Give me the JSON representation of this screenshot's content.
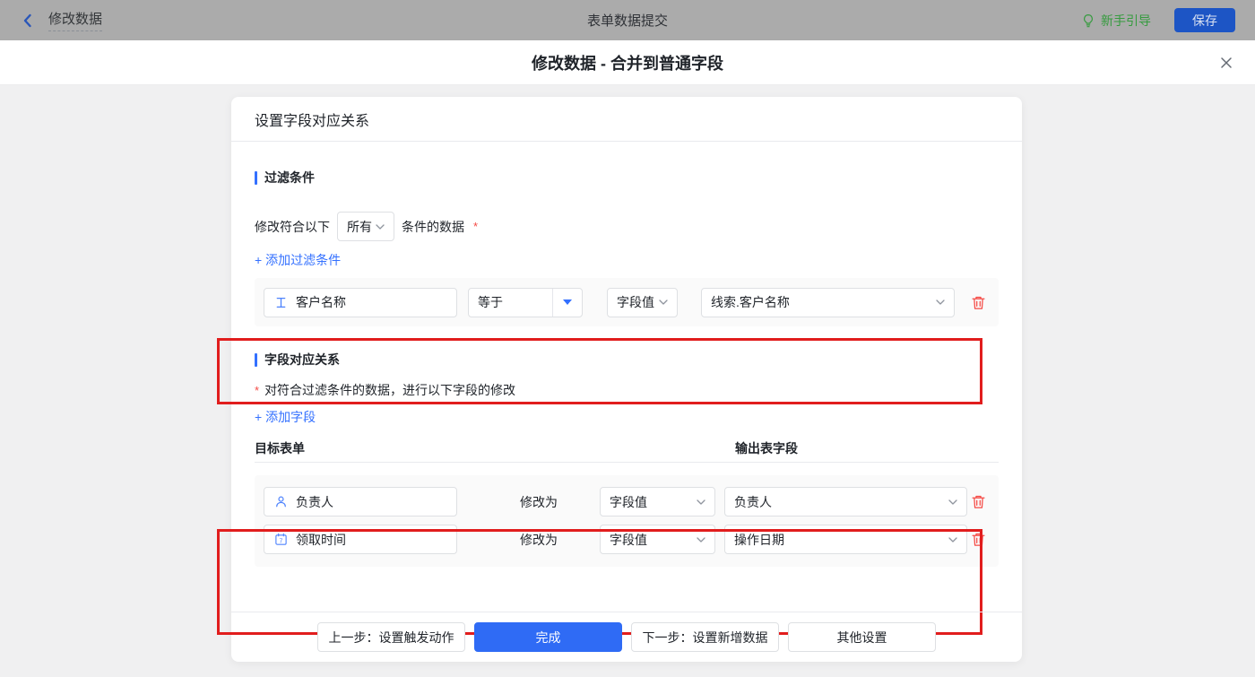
{
  "topbar": {
    "back_label": "修改数据",
    "center_title": "表单数据提交",
    "guide_label": "新手引导",
    "save_label": "保存"
  },
  "modal": {
    "title": "修改数据 - 合并到普通字段"
  },
  "panel": {
    "header": "设置字段对应关系",
    "filter": {
      "section_title": "过滤条件",
      "condition_prefix": "修改符合以下",
      "condition_value": "所有",
      "condition_suffix": "条件的数据",
      "required_mark": "*",
      "add_link": "+ 添加过滤条件",
      "rows": [
        {
          "field": "客户名称",
          "field_icon": "text-field-icon",
          "operator": "等于",
          "value_type": "字段值",
          "value": "线索.客户名称"
        }
      ]
    },
    "mapping": {
      "section_title": "字段对应关系",
      "required_mark": "*",
      "description": "对符合过滤条件的数据，进行以下字段的修改",
      "add_link": "+ 添加字段",
      "column_left": "目标表单",
      "column_right": "输出表字段",
      "rows": [
        {
          "field": "负责人",
          "field_icon": "person-icon",
          "modify_label": "修改为",
          "value_type": "字段值",
          "value": "负责人"
        },
        {
          "field": "领取时间",
          "field_icon": "calendar-icon",
          "modify_label": "修改为",
          "value_type": "字段值",
          "value": "操作日期"
        }
      ]
    },
    "footer": {
      "prev": "上一步：设置触发动作",
      "done": "完成",
      "next": "下一步：设置新增数据",
      "other": "其他设置"
    }
  },
  "colors": {
    "accent_blue": "#3370ff",
    "annotation_red": "#e11d1d",
    "danger_red": "#f54a45",
    "done_button_blue": "#2f6bf5",
    "save_button_blue": "#1d55c5",
    "guide_green": "#359b3e",
    "topbar_gray": "#ababab"
  }
}
